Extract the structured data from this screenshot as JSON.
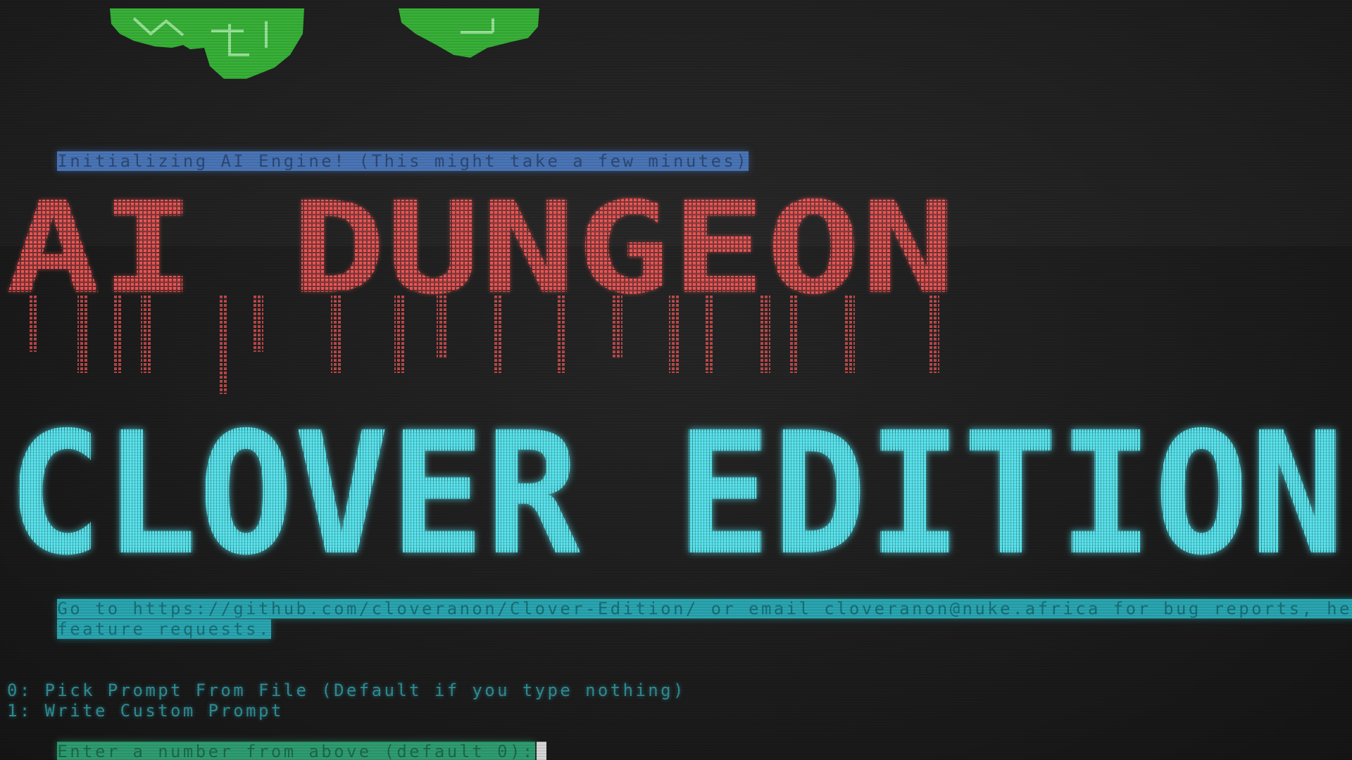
{
  "terminal": {
    "init_message": "Initializing AI Engine! (This might take a few minutes)",
    "help_line_1": "Go to https://github.com/cloveranon/Clover-Edition/ or email cloveranon@nuke.africa for bug reports, help, and",
    "help_line_2": "feature requests.",
    "menu_options": [
      "0: Pick Prompt From File (Default if you type nothing)",
      "1: Write Custom Prompt"
    ],
    "input_prompt": "Enter a number from above (default 0):"
  },
  "banner": {
    "title_line_1": "AI DUNGEON",
    "title_line_2": "CLOVER EDITION"
  },
  "colors": {
    "background": "#1d1d1d",
    "banner_red": "#ff5a5a",
    "banner_cyan": "#5ae6f0",
    "clover_green": "#3bbf3b",
    "init_highlight": "#4a76b8",
    "help_highlight": "#2aa7b2",
    "prompt_highlight": "#2f9e72",
    "menu_text": "#2f8e97"
  },
  "icons": {
    "cursor": "block-cursor-icon",
    "clover_art": "clover-leaf-icon"
  }
}
